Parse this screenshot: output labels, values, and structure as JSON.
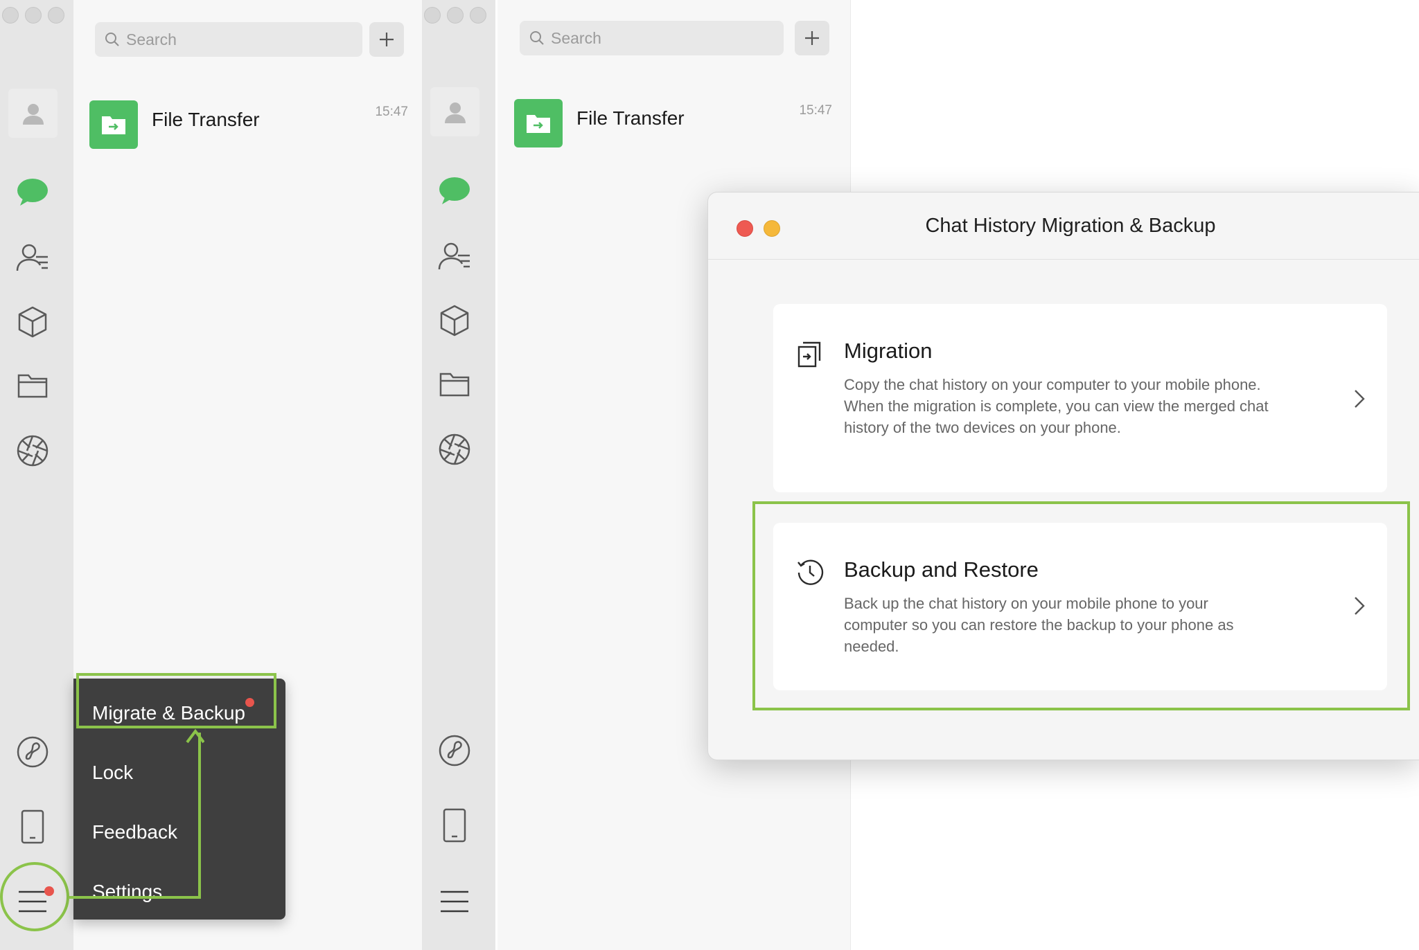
{
  "left_window": {
    "search": {
      "placeholder": "Search"
    },
    "chat": {
      "name": "File Transfer",
      "time": "15:47"
    },
    "menu": {
      "items": [
        {
          "label": "Migrate & Backup",
          "has_badge": true
        },
        {
          "label": "Lock"
        },
        {
          "label": "Feedback"
        },
        {
          "label": "Settings"
        }
      ]
    }
  },
  "right_window": {
    "search": {
      "placeholder": "Search"
    },
    "chat": {
      "name": "File Transfer",
      "time": "15:47"
    }
  },
  "dialog": {
    "title": "Chat History Migration & Backup",
    "options": [
      {
        "title": "Migration",
        "description": "Copy the chat history on your computer to your mobile phone. When the migration is complete, you can view the merged chat history of the two devices on your phone.",
        "icon": "migration-icon"
      },
      {
        "title": "Backup and Restore",
        "description": "Back up the chat history on your mobile phone to your computer so you can restore the backup to your phone as needed.",
        "icon": "history-clock-icon"
      }
    ]
  },
  "colors": {
    "brand_green": "#4fbe64",
    "highlight": "#8bc34a",
    "badge_red": "#e8554d",
    "menu_bg": "#3f3f3f"
  }
}
